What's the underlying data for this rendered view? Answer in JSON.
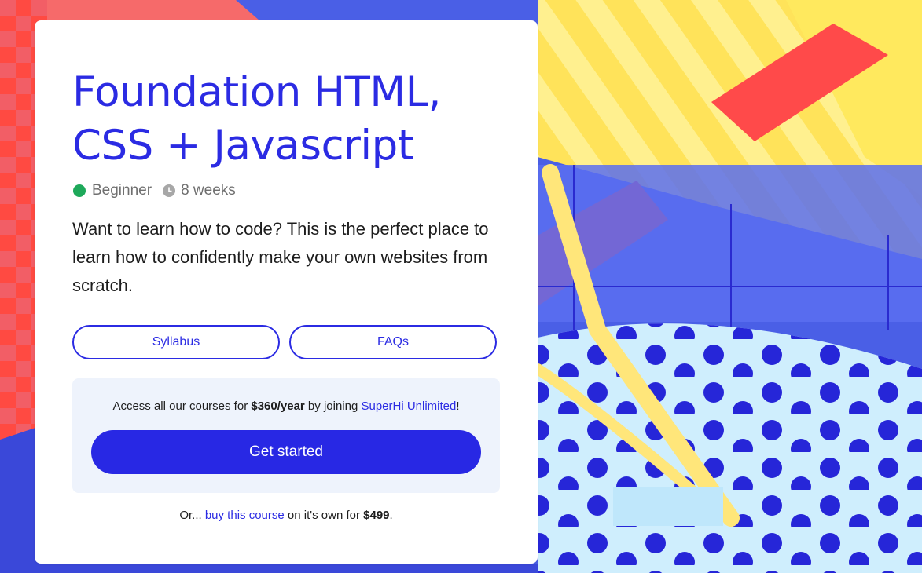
{
  "course": {
    "title": "Foundation HTML, CSS + Javascript",
    "level": "Beginner",
    "duration": "8 weeks",
    "description": "Want to learn how to code? This is the perfect place to learn how to confidently make your own websites from scratch."
  },
  "buttons": {
    "syllabus": "Syllabus",
    "faqs": "FAQs",
    "get_started": "Get started"
  },
  "membership": {
    "prefix": "Access all our courses for ",
    "price": "$360/year",
    "middle": " by joining ",
    "link": "SuperHi Unlimited",
    "suffix": "!"
  },
  "purchase": {
    "prefix": "Or... ",
    "link": "buy this course",
    "middle": " on it's own for ",
    "price": "$499",
    "suffix": "."
  },
  "colors": {
    "accent": "#2b2be3",
    "level_dot": "#1ea95a",
    "panel_bg": "#eef3fc"
  },
  "icons": {
    "level": "green-dot-icon",
    "duration": "clock-icon"
  }
}
